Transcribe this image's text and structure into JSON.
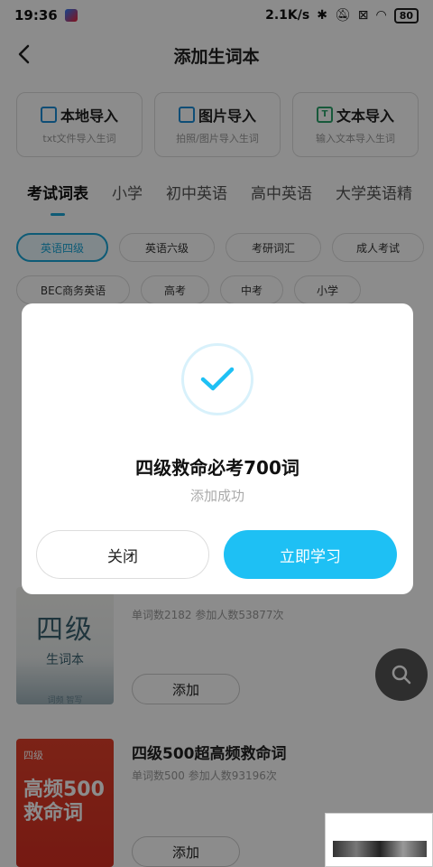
{
  "status": {
    "time": "19:36",
    "speed": "2.1K/s",
    "battery": "80"
  },
  "header": {
    "title": "添加生词本"
  },
  "imports": [
    {
      "label": "本地导入",
      "sub": "txt文件导入生词"
    },
    {
      "label": "图片导入",
      "sub": "拍照/图片导入生词"
    },
    {
      "label": "文本导入",
      "sub": "输入文本导入生词"
    }
  ],
  "tabs": [
    "考试词表",
    "小学",
    "初中英语",
    "高中英语",
    "大学英语精"
  ],
  "chips_row1": [
    "英语四级",
    "英语六级",
    "考研词汇",
    "成人考试"
  ],
  "chips_row2": [
    "BEC商务英语",
    "高考",
    "中考",
    "小学"
  ],
  "books": [
    {
      "cover_big": "四级",
      "cover_small": "生词本",
      "cover_tiny": "词频 智写",
      "name": "",
      "meta": "单词数2182  参加人数53877次",
      "add": "添加"
    },
    {
      "cover_level": "四级",
      "cover_big": "高频500 救命词",
      "name": "四级500超高频救命词",
      "meta": "单词数500  参加人数93196次",
      "add": "添加"
    }
  ],
  "dialog": {
    "title": "四级救命必考700词",
    "subtitle": "添加成功",
    "close": "关闭",
    "study": "立即学习"
  },
  "colors": {
    "accent": "#1ec0f4",
    "tab_underline": "#1aa7d8"
  }
}
